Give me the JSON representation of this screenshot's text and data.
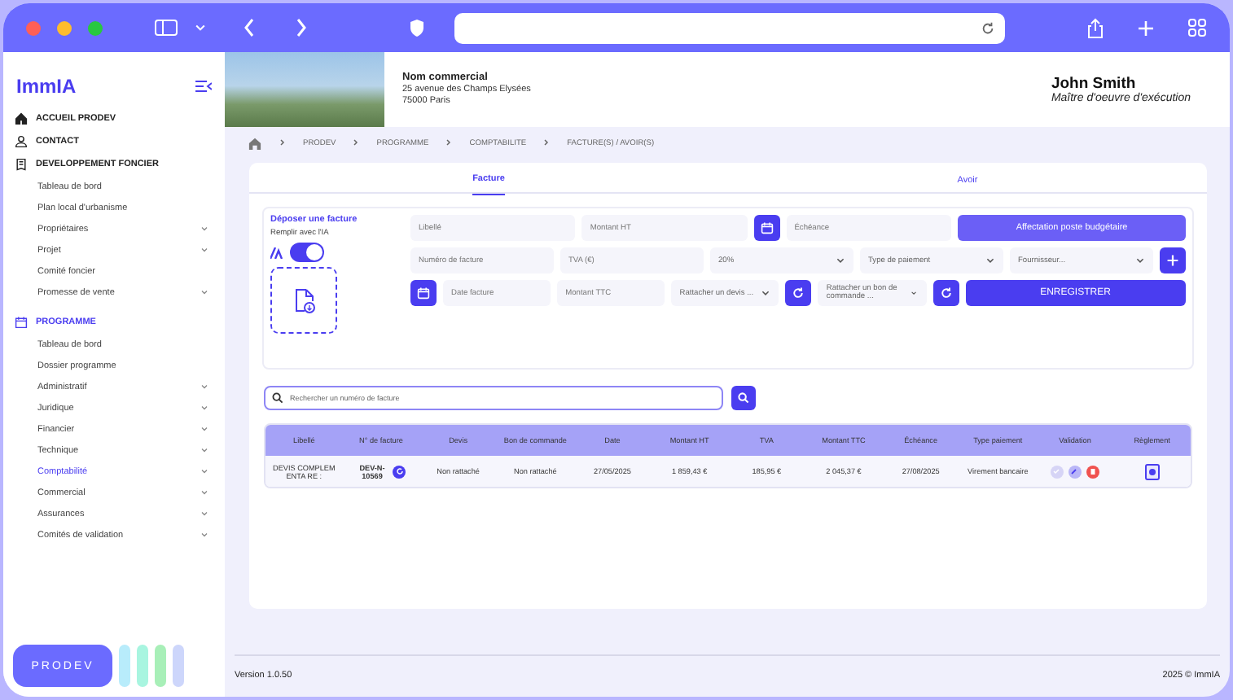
{
  "sidebar": {
    "logo": "ImmIA",
    "sections": [
      {
        "label": "ACCUEIL PRODEV",
        "selected": false
      },
      {
        "label": "CONTACT",
        "selected": false
      },
      {
        "label": "DEVELOPPEMENT FONCIER",
        "selected": false,
        "children": [
          {
            "label": "Tableau de bord",
            "selected": false,
            "has_submenu": false
          },
          {
            "label": "Plan local d'urbanisme",
            "selected": false,
            "has_submenu": false
          },
          {
            "label": "Propriétaires",
            "selected": false,
            "has_submenu": true
          },
          {
            "label": "Projet",
            "selected": false,
            "has_submenu": true
          },
          {
            "label": "Comité foncier",
            "selected": false,
            "has_submenu": false
          },
          {
            "label": "Promesse de vente",
            "selected": false,
            "has_submenu": true
          }
        ]
      },
      {
        "label": "PROGRAMME",
        "selected": true,
        "children": [
          {
            "label": "Tableau de bord",
            "selected": false,
            "has_submenu": false
          },
          {
            "label": "Dossier programme",
            "selected": false,
            "has_submenu": false
          },
          {
            "label": "Administratif",
            "selected": false,
            "has_submenu": true
          },
          {
            "label": "Juridique",
            "selected": false,
            "has_submenu": true
          },
          {
            "label": "Financier",
            "selected": false,
            "has_submenu": true
          },
          {
            "label": "Technique",
            "selected": false,
            "has_submenu": true
          },
          {
            "label": "Comptabilité",
            "selected": true,
            "has_submenu": true
          },
          {
            "label": "Commercial",
            "selected": false,
            "has_submenu": true
          },
          {
            "label": "Assurances",
            "selected": false,
            "has_submenu": true
          },
          {
            "label": "Comités de validation",
            "selected": false,
            "has_submenu": true
          }
        ]
      }
    ],
    "bottom_button": "PRODEV"
  },
  "header": {
    "project_name": "Nom commercial",
    "address_lines": [
      "25 avenue des Champs Elysées",
      "75000 Paris"
    ],
    "user_name": "John Smith",
    "user_role": "Maître d'oeuvre d'exécution"
  },
  "breadcrumb": [
    "PRODEV",
    "PROGRAMME",
    "COMPTABILITE",
    "FACTURE(S) / AVOIR(S)"
  ],
  "tabs": [
    {
      "label": "Facture",
      "selected": true
    },
    {
      "label": "Avoir",
      "selected": false
    }
  ],
  "upload": {
    "title": "Déposer une facture",
    "ai_label": "Remplir avec l'IA",
    "ai_on": true
  },
  "form_rows": [
    [
      {
        "kind": "input",
        "placeholder": "Libellé"
      },
      {
        "kind": "input",
        "placeholder": "Montant HT"
      },
      {
        "kind": "date"
      },
      {
        "kind": "input",
        "placeholder": "Échéance"
      },
      {
        "kind": "button",
        "label": "Affectation poste budgétaire"
      }
    ],
    [
      {
        "kind": "input",
        "placeholder": "Numéro de facture"
      },
      {
        "kind": "input",
        "placeholder": "TVA (€)"
      },
      {
        "kind": "select",
        "value": "20%"
      },
      {
        "kind": "select",
        "placeholder": "Type de paiement"
      },
      {
        "kind": "select",
        "placeholder": "Fournisseur..."
      },
      {
        "kind": "add"
      }
    ],
    [
      {
        "kind": "date"
      },
      {
        "kind": "input",
        "placeholder": "Date facture"
      },
      {
        "kind": "input",
        "placeholder": "Montant TTC"
      },
      {
        "kind": "select",
        "placeholder": "Rattacher un devis ..."
      },
      {
        "kind": "refresh"
      },
      {
        "kind": "select",
        "placeholder": "Rattacher un bon de commande ..."
      },
      {
        "kind": "refresh"
      },
      {
        "kind": "submit",
        "label": "ENREGISTRER"
      }
    ]
  ],
  "search": {
    "placeholder": "Rechercher un numéro de facture"
  },
  "table": {
    "columns": [
      "Libellé",
      "N° de facture",
      "Devis",
      "Bon de commande",
      "Date",
      "Montant HT",
      "TVA",
      "Montant TTC",
      "Échéance",
      "Type paiement",
      "Validation",
      "Règlement"
    ],
    "rows": [
      {
        "libelle": "DEVIS COMPLEM ENTA RE :",
        "number": "DEV-N-10569",
        "devis": "Non rattaché",
        "bon": "Non rattaché",
        "date": "27/05/2025",
        "ht": "1 859,43 €",
        "tva": "185,95 €",
        "ttc": "2 045,37 €",
        "echeance": "27/08/2025",
        "payment": "Virement bancaire",
        "validated": false
      }
    ]
  },
  "footer": {
    "version": "Version 1.0.50",
    "copyright": "2025 © ImmIA"
  }
}
